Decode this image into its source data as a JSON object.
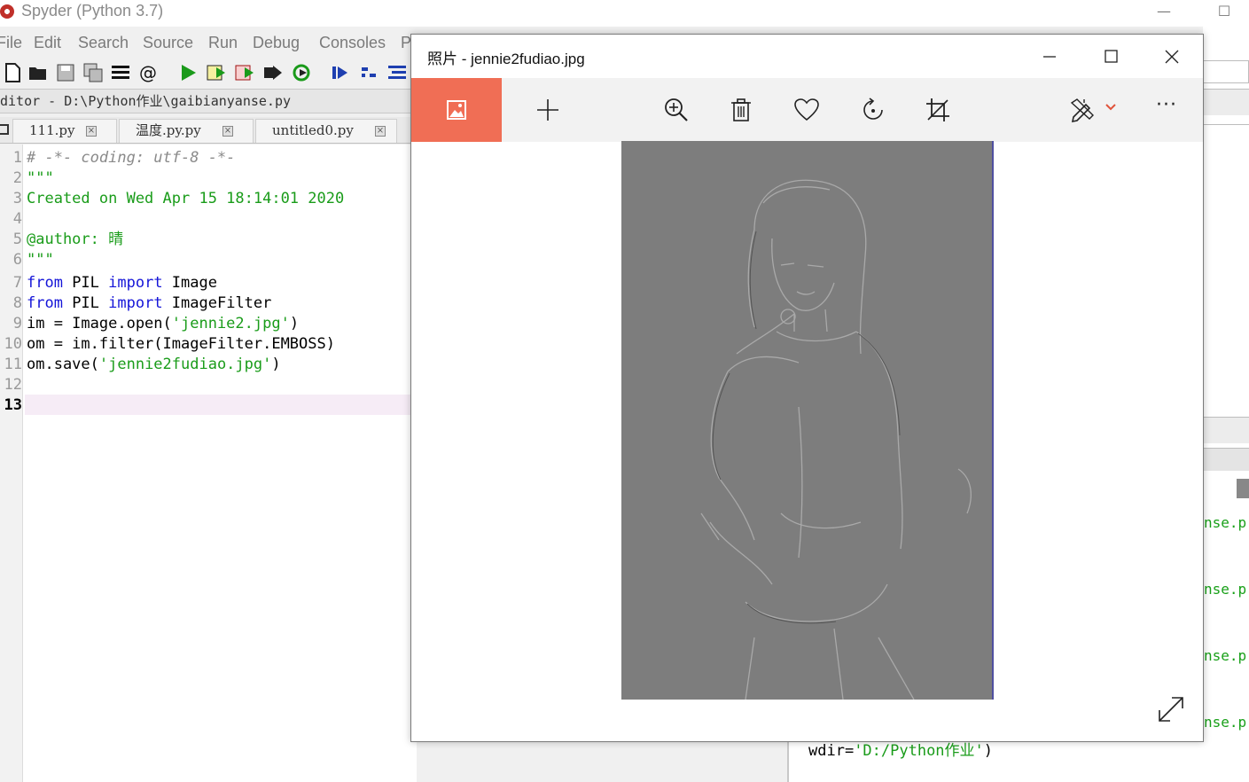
{
  "spyder": {
    "title": "Spyder (Python 3.7)",
    "window_controls": {
      "minimize": "—",
      "maximize": "☐"
    },
    "menu": [
      "File",
      "Edit",
      "Search",
      "Source",
      "Run",
      "Debug",
      "Consoles",
      "P"
    ],
    "editor_header": "ditor - D:\\Python作业\\gaibianyanse.py",
    "tabs": [
      {
        "label": "111.py"
      },
      {
        "label": "温度.py.py"
      },
      {
        "label": "untitled0.py"
      }
    ],
    "code_lines": [
      {
        "num": "1",
        "text": "# -*- coding: utf-8 -*-"
      },
      {
        "num": "2",
        "text": "\"\"\""
      },
      {
        "num": "3",
        "text": "Created on Wed Apr 15 18:14:01 2020"
      },
      {
        "num": "4",
        "text": ""
      },
      {
        "num": "5",
        "text": "@author: 晴"
      },
      {
        "num": "6",
        "text": "\"\"\""
      },
      {
        "num": "7",
        "kw1": "from",
        "mid1": " PIL ",
        "kw2": "import",
        "tail": " Image"
      },
      {
        "num": "8",
        "kw1": "from",
        "mid1": " PIL ",
        "kw2": "import",
        "tail": " ImageFilter"
      },
      {
        "num": "9",
        "pre": "im = Image.open(",
        "str": "'jennie2.jpg'",
        "post": ")"
      },
      {
        "num": "10",
        "pre": "om = im.filter(ImageFilter.EMBOSS)"
      },
      {
        "num": "11",
        "pre": "om.save(",
        "str": "'jennie2fudiao.jpg'",
        "post": ")"
      },
      {
        "num": "12",
        "text": ""
      },
      {
        "num": "13",
        "text": ""
      }
    ],
    "console_fragments": [
      "nse.p",
      "nse.p",
      "nse.p",
      "nse.p"
    ],
    "wdir_line": {
      "pre": "wdir=",
      "str": "'D:/Python作业'",
      "post": ")"
    }
  },
  "photos": {
    "title": "照片 - jennie2fudiao.jpg",
    "accent_color": "#f06e55",
    "toolbar_icons": [
      "view-image-icon",
      "add-icon",
      "zoom-in-icon",
      "delete-icon",
      "favorite-icon",
      "rotate-icon",
      "crop-icon",
      "edit-icon",
      "more-icon"
    ],
    "more_label": "···",
    "image_description_name": "embossed-photo"
  }
}
